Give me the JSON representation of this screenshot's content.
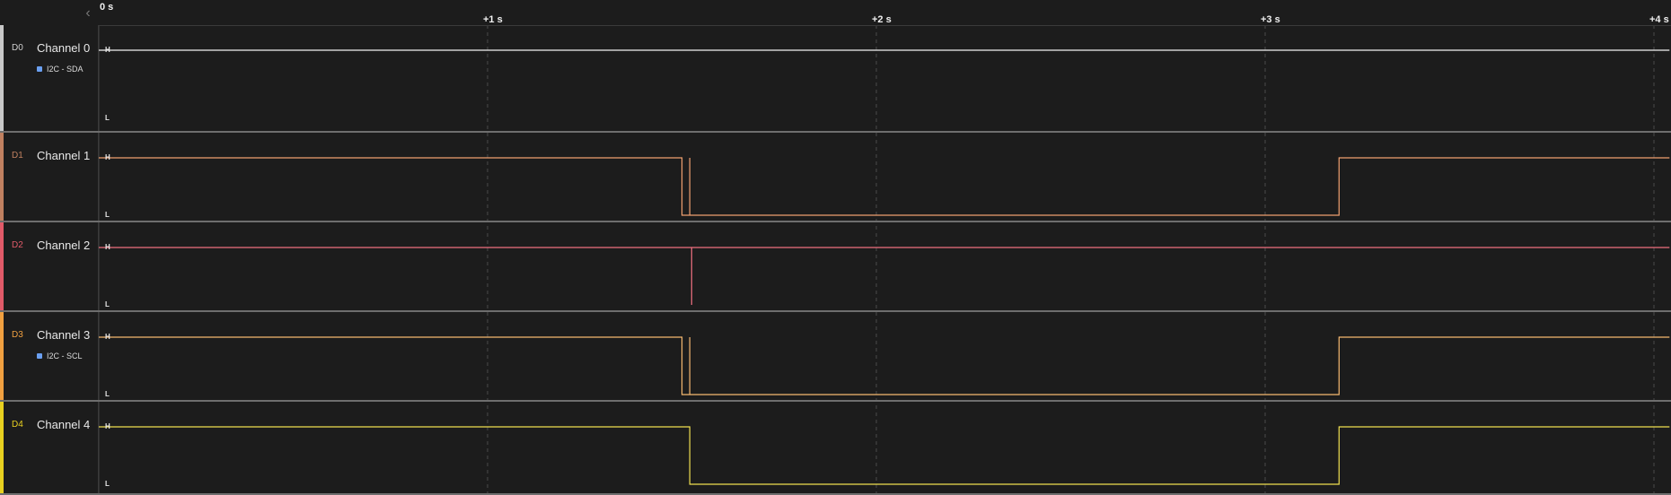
{
  "timeline": {
    "collapse_icon": "chevron-left-icon",
    "ticks": [
      {
        "label": "0 s",
        "t": 0
      },
      {
        "label": "+1 s",
        "t": 1
      },
      {
        "label": "+2 s",
        "t": 2
      },
      {
        "label": "+3 s",
        "t": 3
      },
      {
        "label": "+4 s",
        "t": 4
      }
    ]
  },
  "levels": {
    "high": "H",
    "low": "L"
  },
  "channels": [
    {
      "id": "D0",
      "name": "Channel 0",
      "color": "#c8c8c8",
      "line_color": "#f2f2f2",
      "analyzer": "I2C - SDA",
      "segments": [
        [
          0,
          1
        ],
        [
          4.04,
          1
        ]
      ]
    },
    {
      "id": "D1",
      "name": "Channel 1",
      "color": "#c08060",
      "line_color": "#f0a070",
      "analyzer": null,
      "segments": [
        [
          0,
          1
        ],
        [
          1.5,
          1
        ],
        [
          1.5,
          0
        ],
        [
          1.52,
          0
        ],
        [
          1.52,
          1
        ],
        [
          1.52,
          0
        ],
        [
          3.19,
          0
        ],
        [
          3.19,
          1
        ],
        [
          4.04,
          1
        ]
      ]
    },
    {
      "id": "D2",
      "name": "Channel 2",
      "color": "#e05a68",
      "line_color": "#f07080",
      "analyzer": null,
      "segments": [
        [
          0,
          1
        ],
        [
          1.525,
          1
        ],
        [
          1.525,
          0
        ],
        [
          1.525,
          1
        ],
        [
          4.04,
          1
        ]
      ]
    },
    {
      "id": "D3",
      "name": "Channel 3",
      "color": "#f0a040",
      "line_color": "#f5b870",
      "analyzer": "I2C - SCL",
      "segments": [
        [
          0,
          1
        ],
        [
          1.5,
          1
        ],
        [
          1.5,
          0
        ],
        [
          1.52,
          0
        ],
        [
          1.52,
          1
        ],
        [
          1.52,
          0
        ],
        [
          3.19,
          0
        ],
        [
          3.19,
          1
        ],
        [
          4.04,
          1
        ]
      ]
    },
    {
      "id": "D4",
      "name": "Channel 4",
      "color": "#e8d020",
      "line_color": "#f0e050",
      "analyzer": null,
      "segments": [
        [
          0,
          1
        ],
        [
          1.52,
          1
        ],
        [
          1.52,
          0
        ],
        [
          3.19,
          0
        ],
        [
          3.19,
          1
        ],
        [
          4.04,
          1
        ]
      ]
    }
  ]
}
